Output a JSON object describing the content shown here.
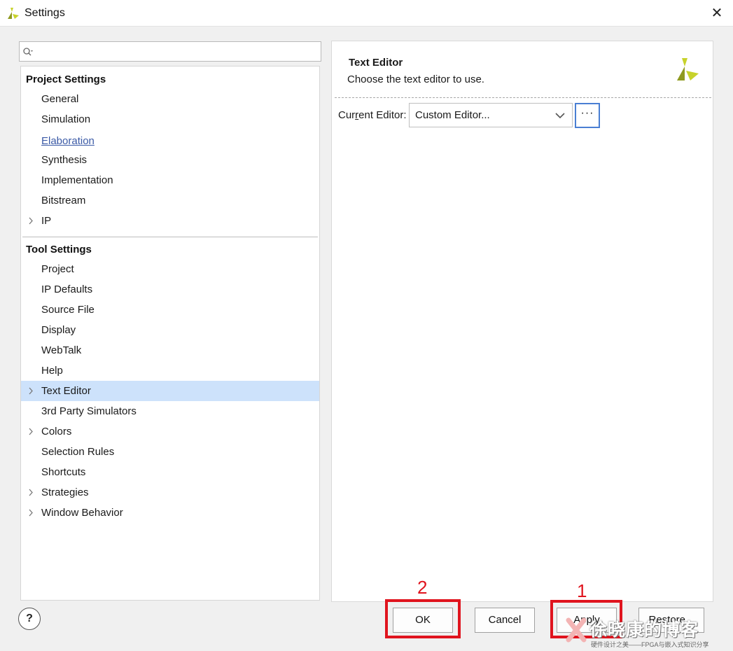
{
  "window": {
    "title": "Settings",
    "close_glyph": "✕"
  },
  "search": {
    "value": "",
    "placeholder": ""
  },
  "tree": {
    "project_header": "Project Settings",
    "project_items": [
      {
        "label": "General",
        "expandable": false,
        "link": false
      },
      {
        "label": "Simulation",
        "expandable": false,
        "link": false
      },
      {
        "label": "Elaboration",
        "expandable": false,
        "link": true
      },
      {
        "label": "Synthesis",
        "expandable": false,
        "link": false
      },
      {
        "label": "Implementation",
        "expandable": false,
        "link": false
      },
      {
        "label": "Bitstream",
        "expandable": false,
        "link": false
      },
      {
        "label": "IP",
        "expandable": true,
        "link": false
      }
    ],
    "tool_header": "Tool Settings",
    "tool_items": [
      {
        "label": "Project",
        "expandable": false
      },
      {
        "label": "IP Defaults",
        "expandable": false
      },
      {
        "label": "Source File",
        "expandable": false
      },
      {
        "label": "Display",
        "expandable": false
      },
      {
        "label": "WebTalk",
        "expandable": false
      },
      {
        "label": "Help",
        "expandable": false
      },
      {
        "label": "Text Editor",
        "expandable": true,
        "selected": true
      },
      {
        "label": "3rd Party Simulators",
        "expandable": false
      },
      {
        "label": "Colors",
        "expandable": true
      },
      {
        "label": "Selection Rules",
        "expandable": false
      },
      {
        "label": "Shortcuts",
        "expandable": false
      },
      {
        "label": "Strategies",
        "expandable": true
      },
      {
        "label": "Window Behavior",
        "expandable": true
      }
    ]
  },
  "panel": {
    "title": "Text Editor",
    "description": "Choose the text editor to use.",
    "editor_label_pre": "Cur",
    "editor_label_mnemonic": "r",
    "editor_label_post": "ent Editor:",
    "editor_value": "Custom Editor...",
    "browse_label": "···"
  },
  "buttons": {
    "help": "?",
    "ok": "OK",
    "cancel": "Cancel",
    "apply": "Apply",
    "restore": "Restore..."
  },
  "annotations": {
    "mark_ok": "2",
    "mark_apply": "1"
  },
  "watermark": {
    "text": "徐晓康的博客",
    "sub": "硬件设计之美——FPGA与嵌入式知识分享"
  },
  "colors": {
    "selection": "#cde2fb",
    "link": "#3b5aa6",
    "annotation": "#e0141e",
    "focus": "#4a7fd3",
    "logo_yellow": "#c7d22b",
    "logo_olive": "#8f9a1f"
  }
}
